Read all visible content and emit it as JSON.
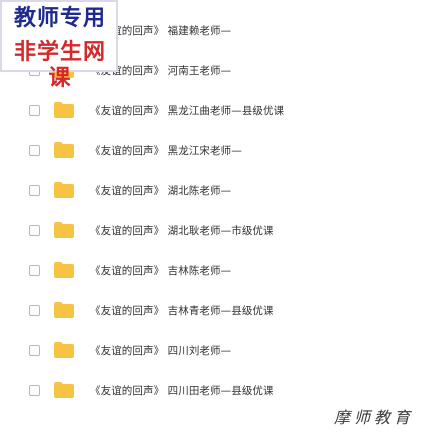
{
  "badge": {
    "line1": "教师专用",
    "line2": "非学生网课"
  },
  "colors": {
    "folder": "#f6c343",
    "badge_top": "#1e2a8c",
    "badge_bottom": "#d4282a",
    "text": "#333333"
  },
  "files": [
    {
      "name": "《友谊的回声》 福建赖老师—"
    },
    {
      "name": "《友谊的回声》 河南王老师—"
    },
    {
      "name": "《友谊的回声》 黑龙江曲老师—县级优课"
    },
    {
      "name": "《友谊的回声》 黑龙江宋老师—"
    },
    {
      "name": "《友谊的回声》 湖北陈老师—"
    },
    {
      "name": "《友谊的回声》 湖北耿老师—市级优课"
    },
    {
      "name": "《友谊的回声》 吉林陈老师—"
    },
    {
      "name": "《友谊的回声》 吉林青老师—县级优课"
    },
    {
      "name": "《友谊的回声》 四川刘老师—"
    },
    {
      "name": "《友谊的回声》 四川田老师—县级优课"
    }
  ],
  "watermark": "摩师教育"
}
